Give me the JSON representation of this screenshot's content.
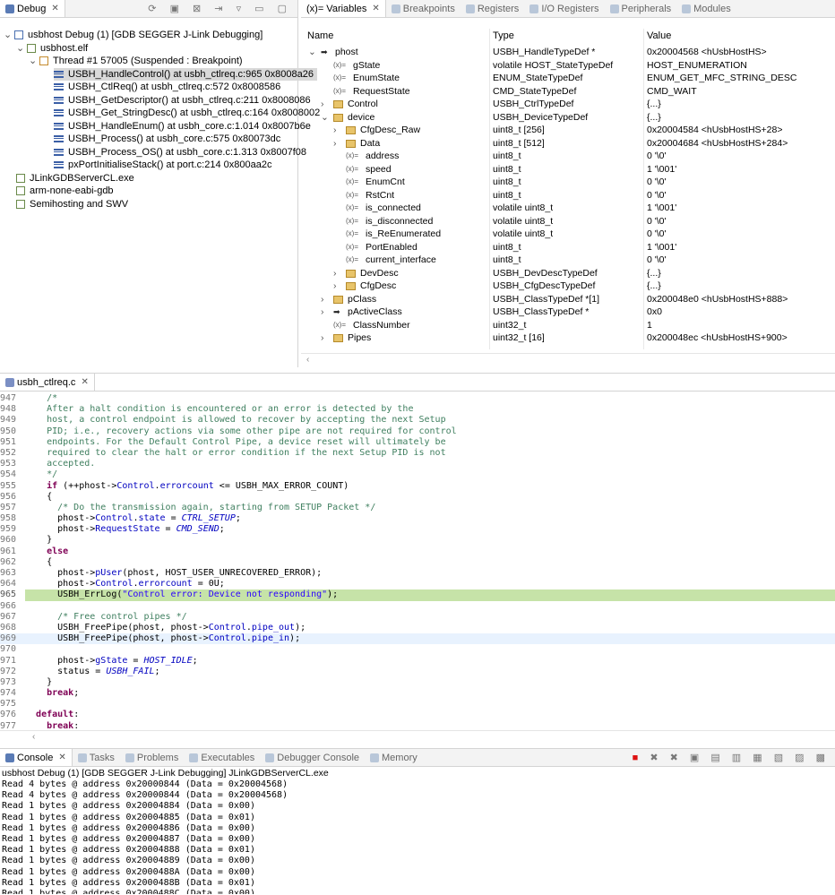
{
  "debug_panel": {
    "tab": "Debug",
    "tree": [
      {
        "label": "usbhost Debug (1) [GDB SEGGER J-Link Debugging]",
        "level": 0,
        "icon": "launch-icon"
      },
      {
        "label": "usbhost.elf",
        "level": 1,
        "icon": "process-icon"
      },
      {
        "label": "Thread #1 57005 (Suspended : Breakpoint)",
        "level": 2,
        "icon": "thread-icon"
      },
      {
        "label": "USBH_HandleControl() at usbh_ctlreq.c:965 0x8008a26",
        "level": 3,
        "icon": "stack-frame-icon",
        "selected": true
      },
      {
        "label": "USBH_CtlReq() at usbh_ctlreq.c:572 0x8008586",
        "level": 3,
        "icon": "stack-frame-icon"
      },
      {
        "label": "USBH_GetDescriptor() at usbh_ctlreq.c:211 0x8008086",
        "level": 3,
        "icon": "stack-frame-icon"
      },
      {
        "label": "USBH_Get_StringDesc() at usbh_ctlreq.c:164 0x8008002",
        "level": 3,
        "icon": "stack-frame-icon"
      },
      {
        "label": "USBH_HandleEnum() at usbh_core.c:1.014 0x8007b6e",
        "level": 3,
        "icon": "stack-frame-icon"
      },
      {
        "label": "USBH_Process() at usbh_core.c:575 0x80073dc",
        "level": 3,
        "icon": "stack-frame-icon"
      },
      {
        "label": "USBH_Process_OS() at usbh_core.c:1.313 0x8007f08",
        "level": 3,
        "icon": "stack-frame-icon"
      },
      {
        "label": "pxPortInitialiseStack() at port.c:214 0x800aa2c",
        "level": 3,
        "icon": "stack-frame-icon"
      },
      {
        "label": "JLinkGDBServerCL.exe",
        "level": 1,
        "icon": "process-icon"
      },
      {
        "label": "arm-none-eabi-gdb",
        "level": 1,
        "icon": "process-icon"
      },
      {
        "label": "Semihosting and SWV",
        "level": 1,
        "icon": "process-icon"
      }
    ]
  },
  "variables_panel": {
    "tabs": [
      "(x)= Variables",
      "Breakpoints",
      "Registers",
      "I/O Registers",
      "Peripherals",
      "Modules"
    ],
    "columns": [
      "Name",
      "Type",
      "Value"
    ],
    "rows": [
      {
        "name": "phost",
        "type": "USBH_HandleTypeDef *",
        "value": "0x20004568 <hUsbHostHS>",
        "level": 0,
        "expander": "open",
        "icon": "pointer-icon"
      },
      {
        "name": "gState",
        "type": "volatile HOST_StateTypeDef",
        "value": "HOST_ENUMERATION",
        "level": 1,
        "expander": "",
        "icon": "variable-icon"
      },
      {
        "name": "EnumState",
        "type": "ENUM_StateTypeDef",
        "value": "ENUM_GET_MFC_STRING_DESC",
        "level": 1,
        "expander": "",
        "icon": "variable-icon"
      },
      {
        "name": "RequestState",
        "type": "CMD_StateTypeDef",
        "value": "CMD_WAIT",
        "level": 1,
        "expander": "",
        "icon": "variable-icon"
      },
      {
        "name": "Control",
        "type": "USBH_CtrlTypeDef",
        "value": "{...}",
        "level": 1,
        "expander": "closed",
        "icon": "struct-icon"
      },
      {
        "name": "device",
        "type": "USBH_DeviceTypeDef",
        "value": "{...}",
        "level": 1,
        "expander": "open",
        "icon": "struct-icon"
      },
      {
        "name": "CfgDesc_Raw",
        "type": "uint8_t [256]",
        "value": "0x20004584 <hUsbHostHS+28>",
        "level": 2,
        "expander": "closed",
        "icon": "struct-icon"
      },
      {
        "name": "Data",
        "type": "uint8_t [512]",
        "value": "0x20004684 <hUsbHostHS+284>",
        "level": 2,
        "expander": "closed",
        "icon": "struct-icon"
      },
      {
        "name": "address",
        "type": "uint8_t",
        "value": "0 '\\0'",
        "level": 2,
        "expander": "",
        "icon": "variable-icon"
      },
      {
        "name": "speed",
        "type": "uint8_t",
        "value": "1 '\\001'",
        "level": 2,
        "expander": "",
        "icon": "variable-icon"
      },
      {
        "name": "EnumCnt",
        "type": "uint8_t",
        "value": "0 '\\0'",
        "level": 2,
        "expander": "",
        "icon": "variable-icon"
      },
      {
        "name": "RstCnt",
        "type": "uint8_t",
        "value": "0 '\\0'",
        "level": 2,
        "expander": "",
        "icon": "variable-icon"
      },
      {
        "name": "is_connected",
        "type": "volatile uint8_t",
        "value": "1 '\\001'",
        "level": 2,
        "expander": "",
        "icon": "variable-icon"
      },
      {
        "name": "is_disconnected",
        "type": "volatile uint8_t",
        "value": "0 '\\0'",
        "level": 2,
        "expander": "",
        "icon": "variable-icon"
      },
      {
        "name": "is_ReEnumerated",
        "type": "volatile uint8_t",
        "value": "0 '\\0'",
        "level": 2,
        "expander": "",
        "icon": "variable-icon"
      },
      {
        "name": "PortEnabled",
        "type": "uint8_t",
        "value": "1 '\\001'",
        "level": 2,
        "expander": "",
        "icon": "variable-icon"
      },
      {
        "name": "current_interface",
        "type": "uint8_t",
        "value": "0 '\\0'",
        "level": 2,
        "expander": "",
        "icon": "variable-icon"
      },
      {
        "name": "DevDesc",
        "type": "USBH_DevDescTypeDef",
        "value": "{...}",
        "level": 2,
        "expander": "closed",
        "icon": "struct-icon"
      },
      {
        "name": "CfgDesc",
        "type": "USBH_CfgDescTypeDef",
        "value": "{...}",
        "level": 2,
        "expander": "closed",
        "icon": "struct-icon"
      },
      {
        "name": "pClass",
        "type": "USBH_ClassTypeDef *[1]",
        "value": "0x200048e0 <hUsbHostHS+888>",
        "level": 1,
        "expander": "closed",
        "icon": "struct-icon"
      },
      {
        "name": "pActiveClass",
        "type": "USBH_ClassTypeDef *",
        "value": "0x0",
        "level": 1,
        "expander": "closed",
        "icon": "pointer-icon"
      },
      {
        "name": "ClassNumber",
        "type": "uint32_t",
        "value": "1",
        "level": 1,
        "expander": "",
        "icon": "variable-icon"
      },
      {
        "name": "Pipes",
        "type": "uint32_t [16]",
        "value": "0x200048ec <hUsbHostHS+900>",
        "level": 1,
        "expander": "closed",
        "icon": "struct-icon"
      }
    ]
  },
  "editor": {
    "tab": "usbh_ctlreq.c",
    "lines": [
      {
        "n": "947",
        "html": "    <span class='cm'>/*</span>"
      },
      {
        "n": "948",
        "html": "<span class='cm'>    After a halt condition is encountered or an error is detected by the</span>"
      },
      {
        "n": "949",
        "html": "<span class='cm'>    host, a control endpoint is allowed to recover by accepting the next Setup</span>"
      },
      {
        "n": "950",
        "html": "<span class='cm'>    PID; i.e., recovery actions via some other pipe are not required for control</span>"
      },
      {
        "n": "951",
        "html": "<span class='cm'>    endpoints. For the Default Control Pipe, a device reset will ultimately be</span>"
      },
      {
        "n": "952",
        "html": "<span class='cm'>    required to clear the halt or error condition if the next Setup PID is not</span>"
      },
      {
        "n": "953",
        "html": "<span class='cm'>    accepted.</span>"
      },
      {
        "n": "954",
        "html": "<span class='cm'>    */</span>"
      },
      {
        "n": "955",
        "html": "    <span class='kw'>if</span> (++phost-&gt;<span class='fld'>Control</span>.<span class='fld'>errorcount</span> &lt;= USBH_MAX_ERROR_COUNT)"
      },
      {
        "n": "956",
        "html": "    {"
      },
      {
        "n": "957",
        "html": "      <span class='cm'>/* Do the transmission again, starting from SETUP Packet */</span>"
      },
      {
        "n": "958",
        "html": "      phost-&gt;<span class='fld'>Control</span>.<span class='fld'>state</span> = <span class='en'>CTRL_SETUP</span>;"
      },
      {
        "n": "959",
        "html": "      phost-&gt;<span class='fld'>RequestState</span> = <span class='en'>CMD_SEND</span>;"
      },
      {
        "n": "960",
        "html": "    }"
      },
      {
        "n": "961",
        "html": "    <span class='kw'>else</span>"
      },
      {
        "n": "962",
        "html": "    {"
      },
      {
        "n": "963",
        "html": "      phost-&gt;<span class='fld'>pUser</span>(phost, HOST_USER_UNRECOVERED_ERROR);"
      },
      {
        "n": "964",
        "html": "      phost-&gt;<span class='fld'>Control</span>.<span class='fld'>errorcount</span> = 0U;"
      },
      {
        "n": "965",
        "html": "      USBH_ErrLog(<span class='str'>\"Control error: Device not responding\"</span>);",
        "current": true
      },
      {
        "n": "966",
        "html": ""
      },
      {
        "n": "967",
        "html": "      <span class='cm'>/* Free control pipes */</span>"
      },
      {
        "n": "968",
        "html": "      USBH_FreePipe(phost, phost-&gt;<span class='fld'>Control</span>.<span class='fld'>pipe_out</span>);"
      },
      {
        "n": "969",
        "html": "      USBH_FreePipe(phost, phost-&gt;<span class='fld'>Control</span>.<span class='fld'>pipe_in</span>);",
        "cursor": true
      },
      {
        "n": "970",
        "html": ""
      },
      {
        "n": "971",
        "html": "      phost-&gt;<span class='fld'>gState</span> = <span class='en'>HOST_IDLE</span>;"
      },
      {
        "n": "972",
        "html": "      status = <span class='en'>USBH_FAIL</span>;"
      },
      {
        "n": "973",
        "html": "    }"
      },
      {
        "n": "974",
        "html": "    <span class='kw'>break</span>;"
      },
      {
        "n": "975",
        "html": ""
      },
      {
        "n": "976",
        "html": "  <span class='kw'>default</span>:"
      },
      {
        "n": "977",
        "html": "    <span class='kw'>break</span>;"
      }
    ]
  },
  "console": {
    "tabs": [
      "Console",
      "Tasks",
      "Problems",
      "Executables",
      "Debugger Console",
      "Memory"
    ],
    "title": "usbhost Debug (1) [GDB SEGGER J-Link Debugging] JLinkGDBServerCL.exe",
    "lines": [
      "Read 4 bytes @ address 0x20000844 (Data = 0x20004568)",
      "Read 4 bytes @ address 0x20000844 (Data = 0x20004568)",
      "Read 1 bytes @ address 0x20004884 (Data = 0x00)",
      "Read 1 bytes @ address 0x20004885 (Data = 0x01)",
      "Read 1 bytes @ address 0x20004886 (Data = 0x00)",
      "Read 1 bytes @ address 0x20004887 (Data = 0x00)",
      "Read 1 bytes @ address 0x20004888 (Data = 0x01)",
      "Read 1 bytes @ address 0x20004889 (Data = 0x00)",
      "Read 1 bytes @ address 0x2000488A (Data = 0x00)",
      "Read 1 bytes @ address 0x2000488B (Data = 0x01)",
      "Read 1 bytes @ address 0x2000488C (Data = 0x00)"
    ]
  }
}
